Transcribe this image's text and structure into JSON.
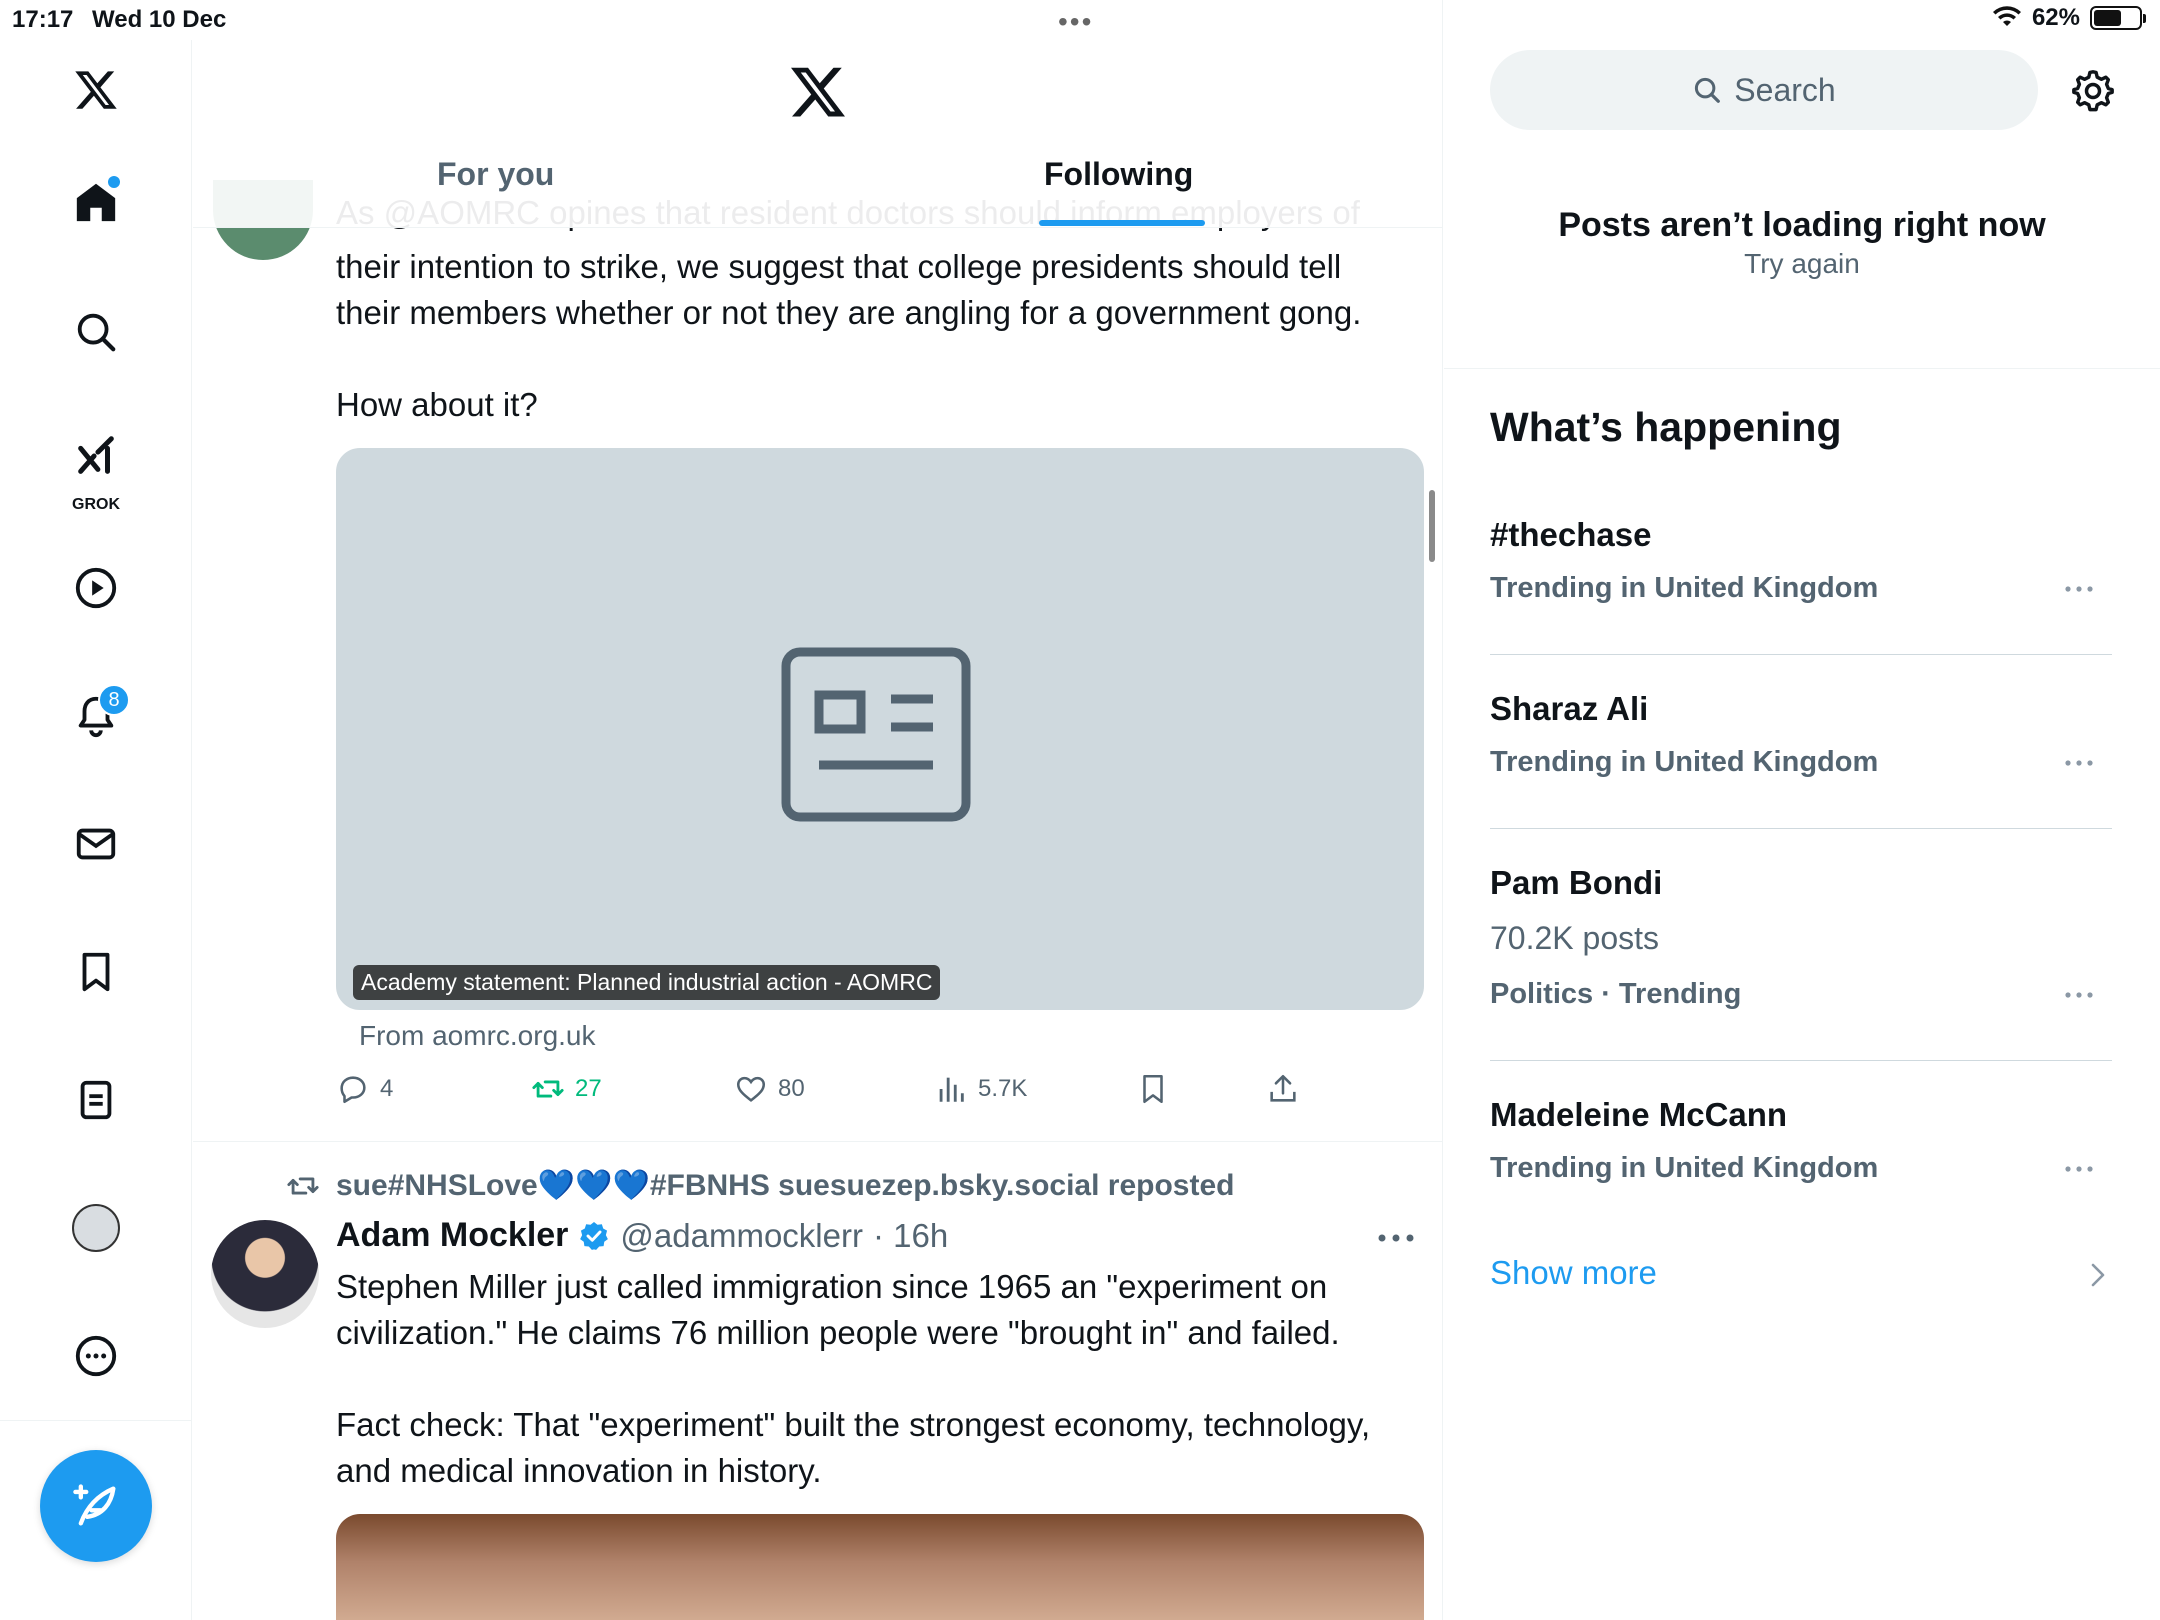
{
  "status_bar": {
    "time": "17:17",
    "date": "Wed 10 Dec",
    "battery": "62%",
    "battery_level": 0.62
  },
  "nav": {
    "notifications_badge": "8",
    "grok_label": "GROK",
    "home_dot": true
  },
  "header": {
    "tabs": [
      "For you",
      "Following"
    ],
    "active_tab": "Following"
  },
  "post1": {
    "partial_line": "As @AOMRC opines that resident doctors should inform employers of",
    "line1": "their intention to strike, we suggest that college presidents should tell",
    "line2": "their members whether or not they are angling for a government gong.",
    "line3": "How about it?",
    "card_caption": "Academy statement: Planned industrial action - AOMRC",
    "card_from": "From aomrc.org.uk",
    "replies": "4",
    "reposts": "27",
    "likes": "80",
    "views": "5.7K"
  },
  "post2": {
    "repost_by_prefix": "sue#NHSLove",
    "repost_hearts": "💙💙💙",
    "repost_by_suffix": "#FBNHS suesuezep.bsky.social reposted",
    "author_name": "Adam Mockler",
    "author_handle": "@adammocklerr",
    "time": "· 16h",
    "line1": "Stephen Miller just called immigration since 1965 an \"experiment on",
    "line2": "civilization.\" He claims 76 million people were \"brought in\" and failed.",
    "line3": "Fact check: That \"experiment\" built the strongest economy, technology,",
    "line4": "and medical innovation in history."
  },
  "right": {
    "search_placeholder": "Search",
    "error_title": "Posts aren’t loading right now",
    "error_retry": "Try again",
    "section_title": "What’s happening",
    "trends": [
      {
        "name": "#thechase",
        "meta": "Trending in United Kingdom",
        "count": ""
      },
      {
        "name": "Sharaz Ali",
        "meta": "Trending in United Kingdom",
        "count": ""
      },
      {
        "name": "Pam Bondi",
        "meta": "Politics · Trending",
        "count": "70.2K posts"
      },
      {
        "name": "Madeleine McCann",
        "meta": "Trending in United Kingdom",
        "count": ""
      }
    ],
    "show_more": "Show more"
  },
  "colors": {
    "accent": "#1d9bf0",
    "repost_green": "#00ba7c",
    "secondary_text": "#536471"
  }
}
